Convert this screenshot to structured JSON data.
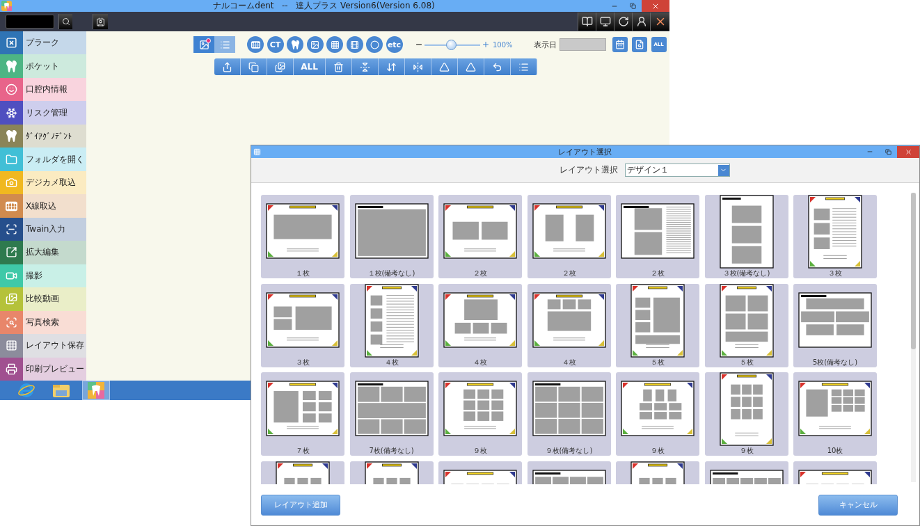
{
  "main_window": {
    "title": "ナルコームdent   --   達人プラス Version6(Version 6.08)"
  },
  "sidebar": {
    "items": [
      {
        "label": "プラーク",
        "color": "#2f74b5"
      },
      {
        "label": "ポケット",
        "color": "#4db584"
      },
      {
        "label": "口腔内情報",
        "color": "#e8648a"
      },
      {
        "label": "リスク管理",
        "color": "#4f4fc0"
      },
      {
        "label": "ﾀﾞｲｱｸﾞﾉﾃﾞﾝﾄ",
        "color": "#8a8458"
      },
      {
        "label": "フォルダを開く",
        "color": "#41bfd6"
      },
      {
        "label": "デジカメ取込",
        "color": "#f0b820"
      },
      {
        "label": "X線取込",
        "color": "#d18b4e"
      },
      {
        "label": "Twain入力",
        "color": "#264f8c"
      },
      {
        "label": "拡大編集",
        "color": "#2e7a4e"
      },
      {
        "label": "撮影",
        "color": "#3fc9a8"
      },
      {
        "label": "比較動画",
        "color": "#b5c23a"
      },
      {
        "label": "写真検索",
        "color": "#e8866a"
      },
      {
        "label": "レイアウト保存",
        "color": "#8c8c9c"
      },
      {
        "label": "印刷プレビュー",
        "color": "#a05090"
      }
    ]
  },
  "view_toggle": [
    {
      "selected": true
    },
    {
      "selected": false
    }
  ],
  "tools": [
    {
      "kind": "icon"
    },
    {
      "kind": "text",
      "label": "CT"
    },
    {
      "kind": "icon"
    },
    {
      "kind": "icon"
    },
    {
      "kind": "icon"
    },
    {
      "kind": "icon"
    },
    {
      "kind": "icon"
    },
    {
      "kind": "text",
      "label": "etc"
    }
  ],
  "zoom": {
    "level": 0.48,
    "reading": "100%"
  },
  "date": {
    "label": "表示日"
  },
  "date_buttons": [
    {
      "kind": "icon"
    },
    {
      "kind": "icon"
    },
    {
      "kind": "text",
      "label": "ALL"
    }
  ],
  "edit_tools": [
    {
      "kind": "icon"
    },
    {
      "kind": "icon"
    },
    {
      "kind": "icon"
    },
    {
      "kind": "text",
      "label": "ALL"
    },
    {
      "kind": "icon"
    },
    {
      "kind": "icon"
    },
    {
      "kind": "icon"
    },
    {
      "kind": "icon"
    },
    {
      "kind": "icon"
    },
    {
      "kind": "icon"
    },
    {
      "kind": "icon"
    },
    {
      "kind": "icon"
    }
  ],
  "taskbar": [
    {
      "selected": false
    },
    {
      "selected": false
    },
    {
      "selected": true
    }
  ],
  "dialog": {
    "title": "レイアウト選択",
    "select_label": "レイアウト選択",
    "select_value": "デザイン１",
    "layouts": [
      {
        "label": "１枚",
        "kind": "corners",
        "portrait": false
      },
      {
        "label": "１枚(備考なし)",
        "kind": "plain",
        "portrait": false
      },
      {
        "label": "２枚",
        "kind": "corners",
        "portrait": false
      },
      {
        "label": "２枚",
        "kind": "corners",
        "portrait": false
      },
      {
        "label": "２枚",
        "kind": "plain",
        "portrait": false
      },
      {
        "label": "３枚(備考なし)",
        "kind": "plain",
        "portrait": true
      },
      {
        "label": "３枚",
        "kind": "corners",
        "portrait": true
      },
      {
        "label": "３枚",
        "kind": "corners",
        "portrait": false
      },
      {
        "label": "４枚",
        "kind": "corners",
        "portrait": true
      },
      {
        "label": "４枚",
        "kind": "corners",
        "portrait": false
      },
      {
        "label": "４枚",
        "kind": "corners",
        "portrait": false
      },
      {
        "label": "５枚",
        "kind": "corners",
        "portrait": true
      },
      {
        "label": "５枚",
        "kind": "corners",
        "portrait": true
      },
      {
        "label": "5枚(備考なし)",
        "kind": "plain",
        "portrait": false
      },
      {
        "label": "７枚",
        "kind": "corners",
        "portrait": false
      },
      {
        "label": "7枚(備考なし)",
        "kind": "plain",
        "portrait": false
      },
      {
        "label": "９枚",
        "kind": "corners",
        "portrait": false
      },
      {
        "label": "９枚(備考なし)",
        "kind": "plain",
        "portrait": false
      },
      {
        "label": "９枚",
        "kind": "corners",
        "portrait": false
      },
      {
        "label": "９枚",
        "kind": "corners",
        "portrait": true
      },
      {
        "label": "10枚",
        "kind": "corners",
        "portrait": false
      },
      {
        "kind": "corners",
        "portrait": true
      },
      {
        "kind": "corners",
        "portrait": true
      },
      {
        "kind": "corners",
        "portrait": false
      },
      {
        "kind": "plain",
        "portrait": false
      },
      {
        "kind": "corners",
        "portrait": true
      },
      {
        "kind": "plain",
        "portrait": false
      },
      {
        "kind": "corners",
        "portrait": false
      }
    ],
    "buttons": [
      "レイアウト追加",
      "キャンセル"
    ]
  }
}
